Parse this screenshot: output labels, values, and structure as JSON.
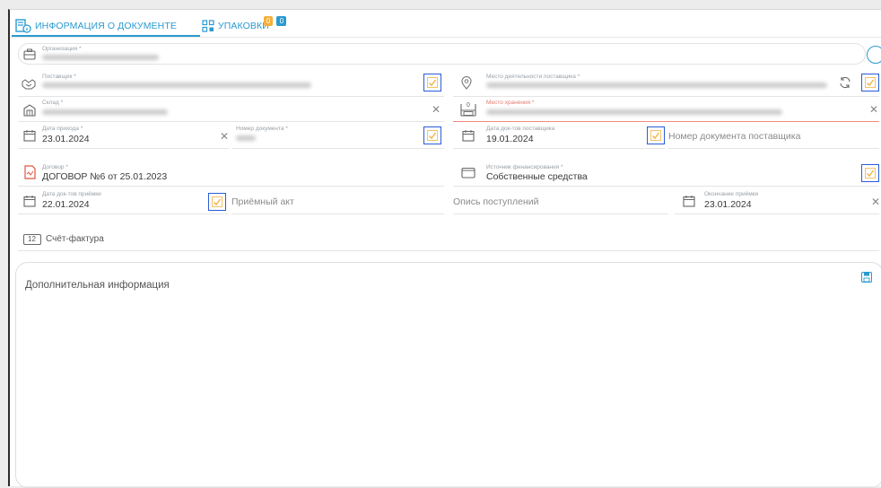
{
  "tabs": [
    {
      "label": "ИНФОРМАЦИЯ О ДОКУМЕНТЕ"
    },
    {
      "label": "УПАКОВКИ",
      "badge_orange": "0",
      "badge_blue": "0"
    }
  ],
  "form": {
    "organization_label": "Организация *",
    "supplier_label": "Поставщик *",
    "supplier_location_label": "Место деятельности поставщика *",
    "warehouse_label": "Склад *",
    "storage_place_label": "Место хранения *",
    "arrival_date_label": "Дата прихода *",
    "arrival_date_value": "23.01.2024",
    "doc_number_label": "Номер документа *",
    "supplier_doc_date_label": "Дата док-тов поставщика",
    "supplier_doc_date_value": "19.01.2024",
    "supplier_doc_number_placeholder": "Номер документа поставщика",
    "contract_label": "Договор *",
    "contract_value": "ДОГОВОР №6 от 25.01.2023",
    "funding_label": "Источник финансирования *",
    "funding_value": "Собственные средства",
    "acceptance_doc_date_label": "Дата док-тов приёмки",
    "acceptance_doc_date_value": "22.01.2024",
    "acceptance_act_placeholder": "Приёмный акт",
    "receipt_inventory_placeholder": "Опись поступлений",
    "acceptance_end_label": "Окончание приёмки",
    "acceptance_end_value": "23.01.2024",
    "invoice_label": "Счёт-фактура",
    "invoice_icon_text": "12",
    "storage_icon_text": "0"
  },
  "additional": {
    "title": "Дополнительная информация"
  },
  "colors": {
    "accent": "#2a9ad0",
    "check_border": "#2a5bd7",
    "check_icon": "#f2b441",
    "error_line": "#f28a80",
    "contract_icon": "#e0553f"
  }
}
